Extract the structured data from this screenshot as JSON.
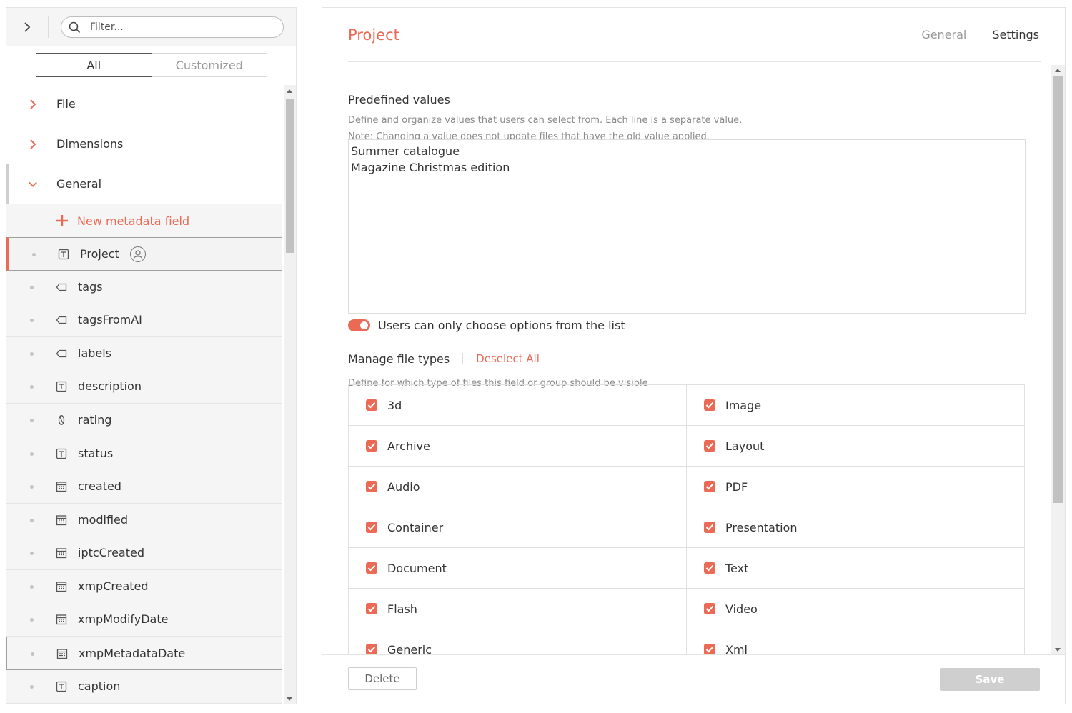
{
  "sidebar": {
    "filter_placeholder": "Filter...",
    "segments": {
      "all": "All",
      "customized": "Customized"
    },
    "groups": [
      {
        "label": "File",
        "state": "collapsed"
      },
      {
        "label": "Dimensions",
        "state": "collapsed"
      },
      {
        "label": "General",
        "state": "expanded"
      }
    ],
    "new_field_label": "New metadata field",
    "fields": [
      {
        "label": "Project",
        "icon": "text-field-icon",
        "selected": true,
        "user_badge": true
      },
      {
        "label": "tags",
        "icon": "tag-icon"
      },
      {
        "label": "tagsFromAI",
        "icon": "tag-icon"
      },
      {
        "label": "labels",
        "icon": "tag-icon"
      },
      {
        "label": "description",
        "icon": "text-field-icon"
      },
      {
        "label": "rating",
        "icon": "rating-icon"
      },
      {
        "label": "status",
        "icon": "text-field-icon"
      },
      {
        "label": "created",
        "icon": "calendar-icon"
      },
      {
        "label": "modified",
        "icon": "calendar-icon"
      },
      {
        "label": "iptcCreated",
        "icon": "calendar-icon"
      },
      {
        "label": "xmpCreated",
        "icon": "calendar-icon"
      },
      {
        "label": "xmpModifyDate",
        "icon": "calendar-icon"
      },
      {
        "label": "xmpMetadataDate",
        "icon": "calendar-icon",
        "outlined": true
      },
      {
        "label": "caption",
        "icon": "text-field-icon"
      }
    ]
  },
  "detail": {
    "title": "Project",
    "tabs": [
      {
        "label": "General",
        "active": false
      },
      {
        "label": "Settings",
        "active": true
      }
    ],
    "predefined": {
      "title": "Predefined values",
      "help1": "Define and organize values that users can select from. Each line is a separate value.",
      "help2": "Note: Changing a value does not update files that have the old value applied.",
      "values": "Summer catalogue\nMagazine Christmas edition"
    },
    "toggle": {
      "label": "Users can only choose options from the list",
      "on": true
    },
    "file_types": {
      "title": "Manage file types",
      "deselect_label": "Deselect All",
      "help": "Define for which type of files this field or group should be visible",
      "items": [
        {
          "label": "3d",
          "checked": true
        },
        {
          "label": "Image",
          "checked": true
        },
        {
          "label": "Archive",
          "checked": true
        },
        {
          "label": "Layout",
          "checked": true
        },
        {
          "label": "Audio",
          "checked": true
        },
        {
          "label": "PDF",
          "checked": true
        },
        {
          "label": "Container",
          "checked": true
        },
        {
          "label": "Presentation",
          "checked": true
        },
        {
          "label": "Document",
          "checked": true
        },
        {
          "label": "Text",
          "checked": true
        },
        {
          "label": "Flash",
          "checked": true
        },
        {
          "label": "Video",
          "checked": true
        },
        {
          "label": "Generic",
          "checked": true
        },
        {
          "label": "Xml",
          "checked": true
        }
      ]
    },
    "footer": {
      "delete_label": "Delete",
      "save_label": "Save"
    }
  },
  "colors": {
    "accent": "#ea6a56",
    "disabled": "#cfcfcf"
  }
}
